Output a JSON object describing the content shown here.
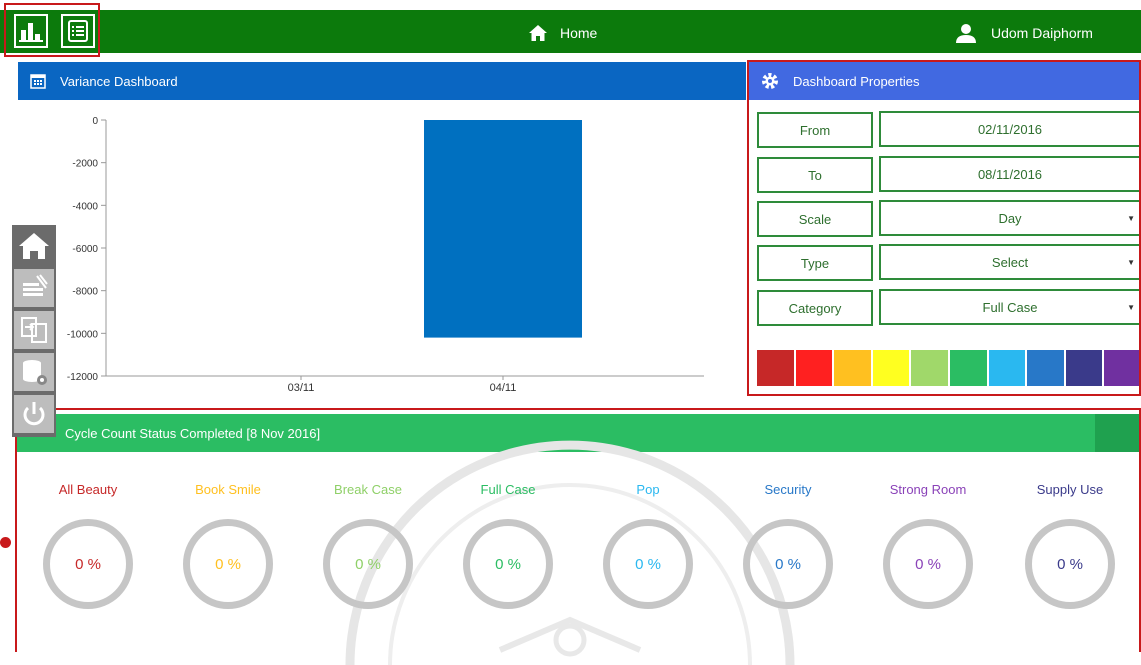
{
  "topbar": {
    "home_label": "Home",
    "user_name": "Udom  Daiphorm"
  },
  "variance": {
    "title": "Variance Dashboard"
  },
  "chart_data": {
    "type": "bar",
    "categories": [
      "03/11",
      "04/11"
    ],
    "values": [
      0,
      -10200
    ],
    "ylim": [
      -12000,
      0
    ],
    "yticks": [
      0,
      -2000,
      -4000,
      -6000,
      -8000,
      -10000,
      -12000
    ],
    "bar_color": "#0070c0",
    "grid": false
  },
  "properties": {
    "title": "Dashboard Properties",
    "rows": [
      {
        "label": "From",
        "value": "02/11/2016",
        "dropdown": false
      },
      {
        "label": "To",
        "value": "08/11/2016",
        "dropdown": false
      },
      {
        "label": "Scale",
        "value": "Day",
        "dropdown": true
      },
      {
        "label": "Type",
        "value": "Select",
        "dropdown": true
      },
      {
        "label": "Category",
        "value": "Full Case",
        "dropdown": true
      }
    ],
    "swatches": [
      "#c62828",
      "#ff2020",
      "#ffc020",
      "#ffff20",
      "#a0d86a",
      "#2bbd63",
      "#2ab8f0",
      "#2878c8",
      "#3a3a8a",
      "#7030a0"
    ]
  },
  "sidemenu": {
    "items": [
      "home-icon",
      "stack-icon",
      "transfer-icon",
      "database-settings-icon",
      "power-icon"
    ]
  },
  "cycle": {
    "title": "Cycle Count Status Completed [8 Nov 2016]",
    "categories": [
      {
        "name": "All Beauty",
        "value": "0 %",
        "color": "#c62828"
      },
      {
        "name": "Book Smile",
        "value": "0 %",
        "color": "#ffc020"
      },
      {
        "name": "Break Case",
        "value": "0 %",
        "color": "#8fd068"
      },
      {
        "name": "Full Case",
        "value": "0 %",
        "color": "#2bbd63"
      },
      {
        "name": "Pop",
        "value": "0 %",
        "color": "#2ab8f0"
      },
      {
        "name": "Security",
        "value": "0 %",
        "color": "#2878c8"
      },
      {
        "name": "Strong Room",
        "value": "0 %",
        "color": "#8a42b8"
      },
      {
        "name": "Supply Use",
        "value": "0 %",
        "color": "#3a3a8a"
      }
    ]
  }
}
